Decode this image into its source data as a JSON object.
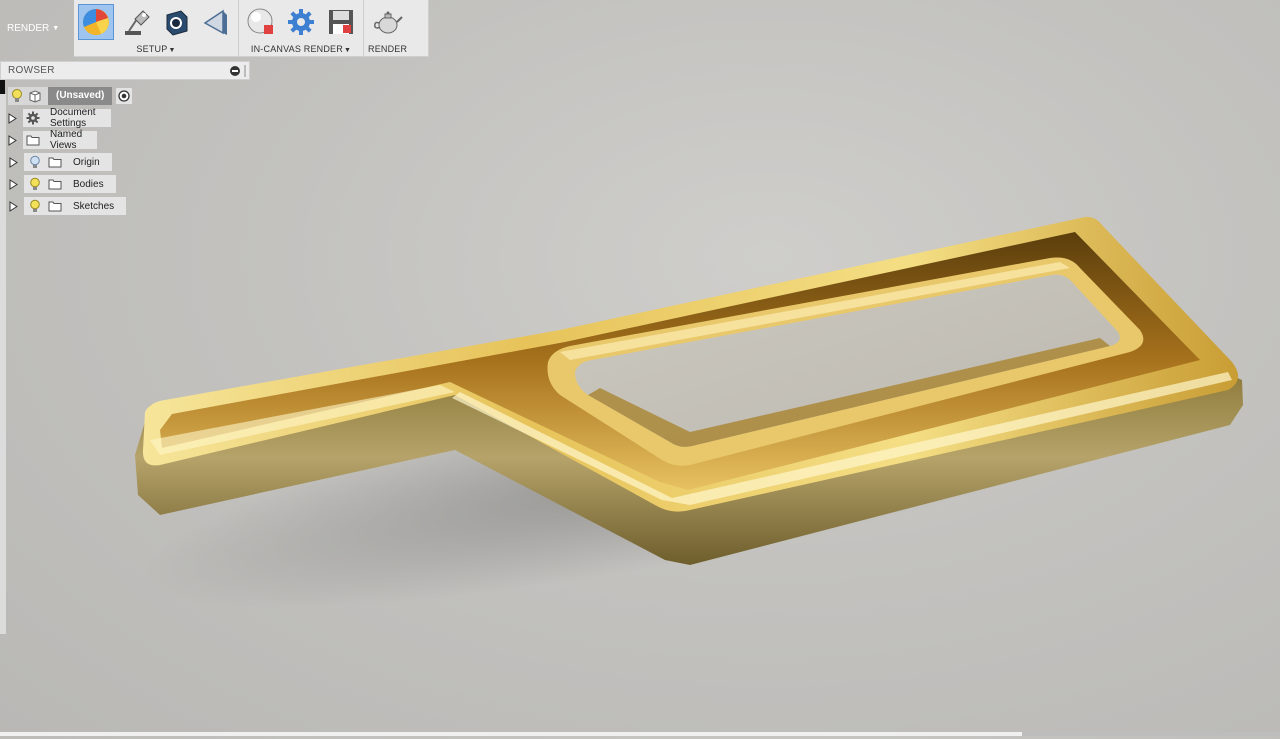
{
  "workspace": {
    "label": "RENDER"
  },
  "toolbar": {
    "groups": [
      {
        "label": "SETUP",
        "items": [
          "scene-settings-icon",
          "appearance-lamp-icon",
          "decal-icon",
          "texture-map-icon"
        ]
      },
      {
        "label": "IN-CANVAS RENDER",
        "items": [
          "in-canvas-render-icon",
          "render-settings-gear-icon",
          "capture-image-icon"
        ]
      },
      {
        "label": "RENDER",
        "items": [
          "render-teapot-icon"
        ]
      }
    ]
  },
  "browser": {
    "title": "ROWSER",
    "root": {
      "label": "(Unsaved)"
    },
    "items": [
      {
        "label": "Document Settings",
        "icon": "gear-icon"
      },
      {
        "label": "Named Views",
        "icon": "folder-icon"
      },
      {
        "label": "Origin",
        "icon": "folder-icon",
        "bulb": "off"
      },
      {
        "label": "Bodies",
        "icon": "folder-icon",
        "bulb": "on"
      },
      {
        "label": "Sketches",
        "icon": "folder-icon",
        "bulb": "on"
      }
    ]
  },
  "colors": {
    "toolbar_bg": "#e9e9e9",
    "active_tool": "#9ec5f0",
    "canvas_bg": "#c3c2bf",
    "gold": "#c9a227"
  }
}
